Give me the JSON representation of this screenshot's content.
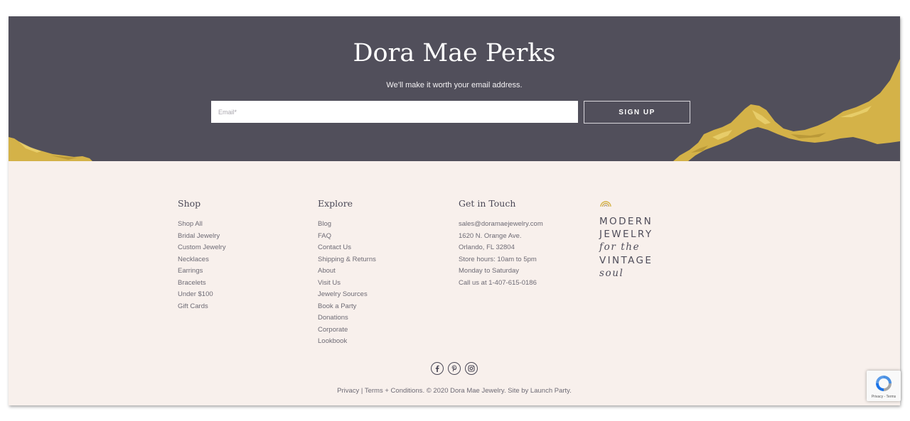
{
  "hero": {
    "title": "Dora Mae Perks",
    "subtitle": "We’ll make it worth your email address.",
    "email_placeholder": "Email*",
    "signup_label": "SIGN UP",
    "background_color": "#514f5b",
    "gold_color": "#d4b248"
  },
  "footer": {
    "background_color": "#f8f0ec",
    "shop": {
      "heading": "Shop",
      "items": [
        "Shop All",
        "Bridal Jewelry",
        "Custom Jewelry",
        "Necklaces",
        "Earrings",
        "Bracelets",
        "Under $100",
        "Gift Cards"
      ]
    },
    "explore": {
      "heading": "Explore",
      "items": [
        "Blog",
        "FAQ",
        "Contact Us",
        "Shipping & Returns",
        "About",
        "Visit Us",
        "Jewelry Sources",
        "Book a Party",
        "Donations",
        "Corporate",
        "Lookbook"
      ]
    },
    "contact": {
      "heading": "Get in Touch",
      "items": [
        "sales@doramaejewelry.com",
        "1620 N. Orange Ave.",
        "Orlando, FL 32804",
        "Store hours: 10am to 5pm",
        "Monday to Saturday",
        "Call us at 1-407-615-0186"
      ]
    },
    "tagline": {
      "line1": "MODERN",
      "line2": "JEWELRY",
      "line3": "for the",
      "line4": "VINTAGE",
      "line5": "soul"
    },
    "social": [
      "facebook-icon",
      "pinterest-icon",
      "instagram-icon"
    ],
    "legal": {
      "privacy": "Privacy",
      "separator": " | ",
      "terms": "Terms + Conditions",
      "copyright": ". © 2020 Dora Mae Jewelry. Site by Launch Party."
    }
  },
  "recaptcha": {
    "text": "Privacy - Terms"
  }
}
